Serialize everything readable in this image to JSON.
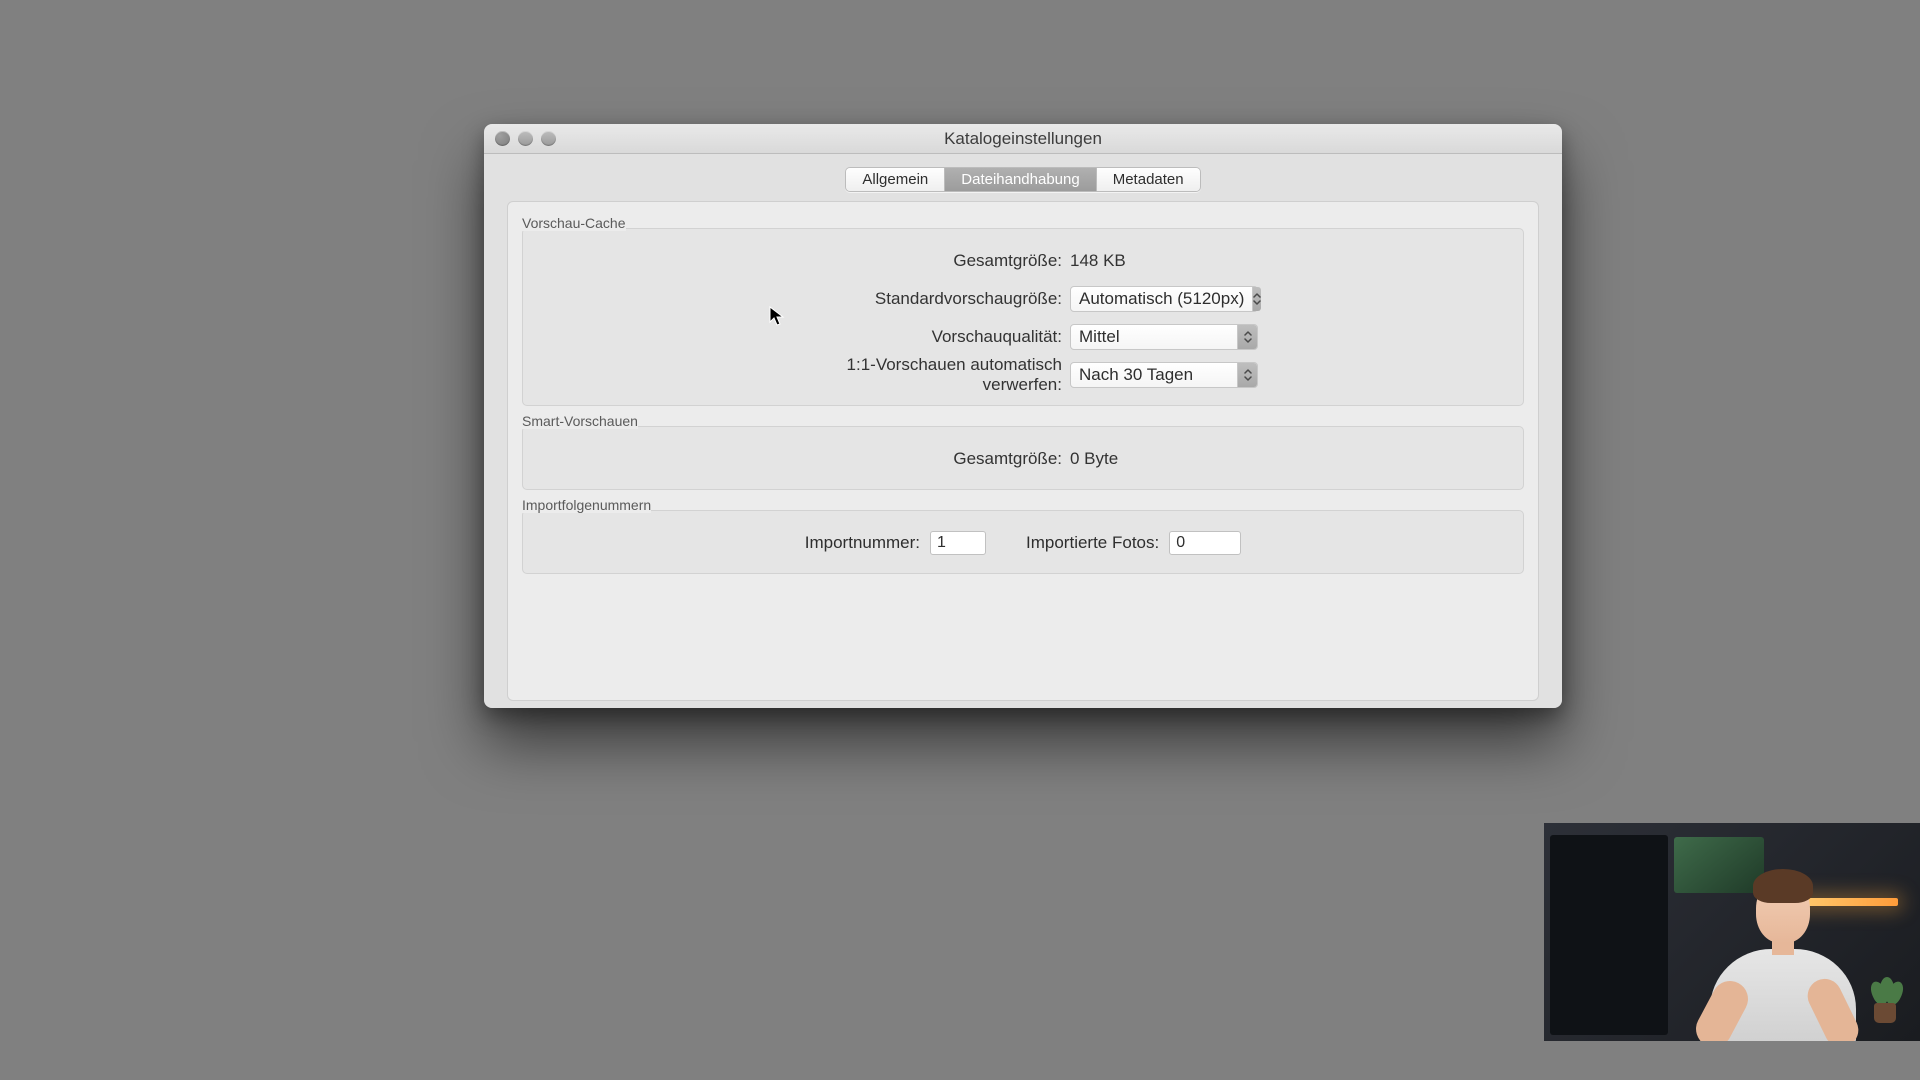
{
  "window": {
    "title": "Katalogeinstellungen"
  },
  "tabs": {
    "general": "Allgemein",
    "file": "Dateihandhabung",
    "meta": "Metadaten"
  },
  "previewCache": {
    "legend": "Vorschau-Cache",
    "totalSizeLabel": "Gesamtgröße:",
    "totalSize": "148 KB",
    "stdSizeLabel": "Standardvorschaugröße:",
    "stdSize": "Automatisch (5120px)",
    "qualityLabel": "Vorschauqualität:",
    "quality": "Mittel",
    "discardLabel": "1:1-Vorschauen automatisch verwerfen:",
    "discard": "Nach 30 Tagen"
  },
  "smartPreviews": {
    "legend": "Smart-Vorschauen",
    "totalSizeLabel": "Gesamtgröße:",
    "totalSize": "0 Byte"
  },
  "importSeq": {
    "legend": "Importfolgenummern",
    "importNoLabel": "Importnummer:",
    "importNo": "1",
    "importedLabel": "Importierte Fotos:",
    "imported": "0"
  }
}
